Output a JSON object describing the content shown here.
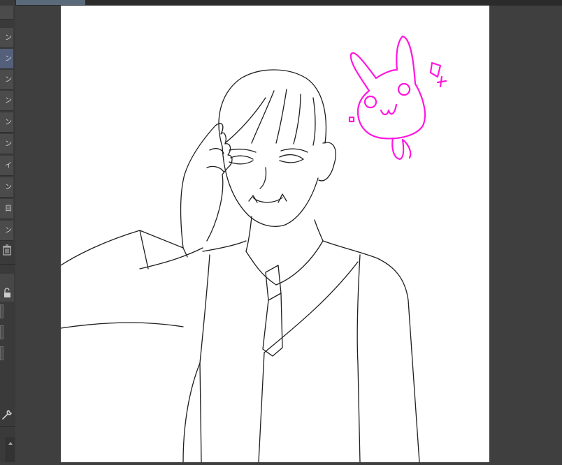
{
  "layers_panel": {
    "items": [
      {
        "label": "ン"
      },
      {
        "label": "ン",
        "selected": true
      },
      {
        "label": "ン"
      },
      {
        "label": "ン"
      },
      {
        "label": "ン"
      },
      {
        "label": "ン"
      },
      {
        "label": "イ"
      },
      {
        "label": "ン"
      },
      {
        "label": "目"
      },
      {
        "label": "ン"
      }
    ]
  },
  "icons": [
    "trash-icon",
    "lock-icon",
    "wrench-icon",
    "scroll-up-icon"
  ],
  "colors": {
    "ui_background": "#3f3f3f",
    "panel_row": "#4b4b4b",
    "selected_row": "#54607a",
    "canvas": "#ffffff",
    "lineart": "#1e1e1e",
    "doodle": "#ff17e0"
  }
}
